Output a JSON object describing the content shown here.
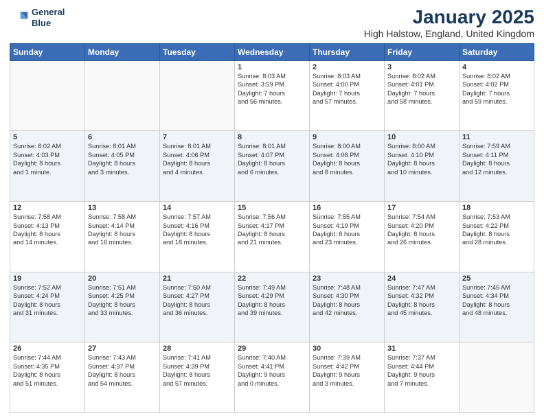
{
  "logo": {
    "line1": "General",
    "line2": "Blue"
  },
  "title": "January 2025",
  "location": "High Halstow, England, United Kingdom",
  "weekdays": [
    "Sunday",
    "Monday",
    "Tuesday",
    "Wednesday",
    "Thursday",
    "Friday",
    "Saturday"
  ],
  "weeks": [
    [
      {
        "day": "",
        "info": ""
      },
      {
        "day": "",
        "info": ""
      },
      {
        "day": "",
        "info": ""
      },
      {
        "day": "1",
        "info": "Sunrise: 8:03 AM\nSunset: 3:59 PM\nDaylight: 7 hours\nand 56 minutes."
      },
      {
        "day": "2",
        "info": "Sunrise: 8:03 AM\nSunset: 4:00 PM\nDaylight: 7 hours\nand 57 minutes."
      },
      {
        "day": "3",
        "info": "Sunrise: 8:02 AM\nSunset: 4:01 PM\nDaylight: 7 hours\nand 58 minutes."
      },
      {
        "day": "4",
        "info": "Sunrise: 8:02 AM\nSunset: 4:02 PM\nDaylight: 7 hours\nand 59 minutes."
      }
    ],
    [
      {
        "day": "5",
        "info": "Sunrise: 8:02 AM\nSunset: 4:03 PM\nDaylight: 8 hours\nand 1 minute."
      },
      {
        "day": "6",
        "info": "Sunrise: 8:01 AM\nSunset: 4:05 PM\nDaylight: 8 hours\nand 3 minutes."
      },
      {
        "day": "7",
        "info": "Sunrise: 8:01 AM\nSunset: 4:06 PM\nDaylight: 8 hours\nand 4 minutes."
      },
      {
        "day": "8",
        "info": "Sunrise: 8:01 AM\nSunset: 4:07 PM\nDaylight: 8 hours\nand 6 minutes."
      },
      {
        "day": "9",
        "info": "Sunrise: 8:00 AM\nSunset: 4:08 PM\nDaylight: 8 hours\nand 8 minutes."
      },
      {
        "day": "10",
        "info": "Sunrise: 8:00 AM\nSunset: 4:10 PM\nDaylight: 8 hours\nand 10 minutes."
      },
      {
        "day": "11",
        "info": "Sunrise: 7:59 AM\nSunset: 4:11 PM\nDaylight: 8 hours\nand 12 minutes."
      }
    ],
    [
      {
        "day": "12",
        "info": "Sunrise: 7:58 AM\nSunset: 4:13 PM\nDaylight: 8 hours\nand 14 minutes."
      },
      {
        "day": "13",
        "info": "Sunrise: 7:58 AM\nSunset: 4:14 PM\nDaylight: 8 hours\nand 16 minutes."
      },
      {
        "day": "14",
        "info": "Sunrise: 7:57 AM\nSunset: 4:16 PM\nDaylight: 8 hours\nand 18 minutes."
      },
      {
        "day": "15",
        "info": "Sunrise: 7:56 AM\nSunset: 4:17 PM\nDaylight: 8 hours\nand 21 minutes."
      },
      {
        "day": "16",
        "info": "Sunrise: 7:55 AM\nSunset: 4:19 PM\nDaylight: 8 hours\nand 23 minutes."
      },
      {
        "day": "17",
        "info": "Sunrise: 7:54 AM\nSunset: 4:20 PM\nDaylight: 8 hours\nand 26 minutes."
      },
      {
        "day": "18",
        "info": "Sunrise: 7:53 AM\nSunset: 4:22 PM\nDaylight: 8 hours\nand 28 minutes."
      }
    ],
    [
      {
        "day": "19",
        "info": "Sunrise: 7:52 AM\nSunset: 4:24 PM\nDaylight: 8 hours\nand 31 minutes."
      },
      {
        "day": "20",
        "info": "Sunrise: 7:51 AM\nSunset: 4:25 PM\nDaylight: 8 hours\nand 33 minutes."
      },
      {
        "day": "21",
        "info": "Sunrise: 7:50 AM\nSunset: 4:27 PM\nDaylight: 8 hours\nand 36 minutes."
      },
      {
        "day": "22",
        "info": "Sunrise: 7:49 AM\nSunset: 4:29 PM\nDaylight: 8 hours\nand 39 minutes."
      },
      {
        "day": "23",
        "info": "Sunrise: 7:48 AM\nSunset: 4:30 PM\nDaylight: 8 hours\nand 42 minutes."
      },
      {
        "day": "24",
        "info": "Sunrise: 7:47 AM\nSunset: 4:32 PM\nDaylight: 8 hours\nand 45 minutes."
      },
      {
        "day": "25",
        "info": "Sunrise: 7:45 AM\nSunset: 4:34 PM\nDaylight: 8 hours\nand 48 minutes."
      }
    ],
    [
      {
        "day": "26",
        "info": "Sunrise: 7:44 AM\nSunset: 4:35 PM\nDaylight: 8 hours\nand 51 minutes."
      },
      {
        "day": "27",
        "info": "Sunrise: 7:43 AM\nSunset: 4:37 PM\nDaylight: 8 hours\nand 54 minutes."
      },
      {
        "day": "28",
        "info": "Sunrise: 7:41 AM\nSunset: 4:39 PM\nDaylight: 8 hours\nand 57 minutes."
      },
      {
        "day": "29",
        "info": "Sunrise: 7:40 AM\nSunset: 4:41 PM\nDaylight: 9 hours\nand 0 minutes."
      },
      {
        "day": "30",
        "info": "Sunrise: 7:39 AM\nSunset: 4:42 PM\nDaylight: 9 hours\nand 3 minutes."
      },
      {
        "day": "31",
        "info": "Sunrise: 7:37 AM\nSunset: 4:44 PM\nDaylight: 9 hours\nand 7 minutes."
      },
      {
        "day": "",
        "info": ""
      }
    ]
  ]
}
